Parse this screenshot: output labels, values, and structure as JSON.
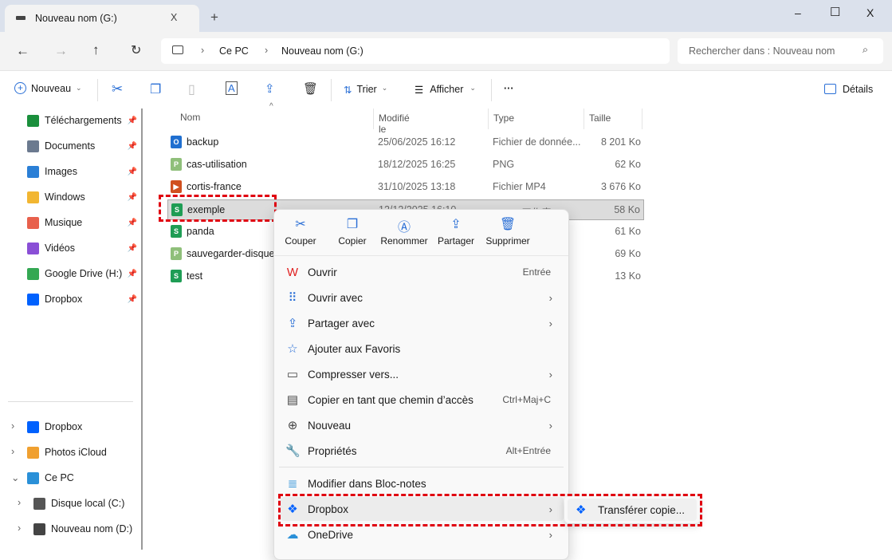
{
  "window": {
    "tab_title": "Nouveau nom (G:)",
    "tab_close": "X",
    "new_tab": "+",
    "minimize": "–",
    "maximize": "☐",
    "close": "X"
  },
  "address": {
    "crumbs": [
      "Ce PC",
      "Nouveau nom (G:)"
    ],
    "search_placeholder": "Rechercher dans : Nouveau nom"
  },
  "toolbar": {
    "new_label": "Nouveau",
    "sort_label": "Trier",
    "view_label": "Afficher",
    "more": "···",
    "details_label": "Détails"
  },
  "sidebar": {
    "quick": [
      {
        "label": "Téléchargements",
        "color": "#1a8f3c"
      },
      {
        "label": "Documents",
        "color": "#6b7a8f"
      },
      {
        "label": "Images",
        "color": "#2b7fd6"
      },
      {
        "label": "Windows",
        "color": "#f2b632"
      },
      {
        "label": "Musique",
        "color": "#e8604c"
      },
      {
        "label": "Vidéos",
        "color": "#8a4fd6"
      },
      {
        "label": "Google Drive (H:)",
        "color": "#34a853"
      },
      {
        "label": "Dropbox",
        "color": "#0061fe"
      }
    ],
    "tree": [
      {
        "label": "Dropbox",
        "color": "#0061fe",
        "chev": "›"
      },
      {
        "label": "Photos iCloud",
        "color": "#f0a030",
        "chev": "›"
      },
      {
        "label": "Ce PC",
        "color": "#2a90d8",
        "chev": "⌄"
      },
      {
        "label": "Disque local (C:)",
        "color": "#555",
        "chev": "›"
      },
      {
        "label": "Nouveau nom (D:)",
        "color": "#444",
        "chev": "›"
      }
    ]
  },
  "columns": {
    "name": "Nom",
    "modified": "Modifié le",
    "type": "Type",
    "size": "Taille"
  },
  "files": [
    {
      "name": "backup",
      "modified": "25/06/2025 16:12",
      "type": "Fichier de donnée...",
      "size": "8 201 Ko",
      "icon": "O",
      "color": "#1f6fd0"
    },
    {
      "name": "cas-utilisation",
      "modified": "18/12/2025 16:25",
      "type": "PNG",
      "size": "62 Ko",
      "icon": "P",
      "color": "#8fbf7a"
    },
    {
      "name": "cortis-france",
      "modified": "31/10/2025 13:18",
      "type": "Fichier MP4",
      "size": "3 676 Ko",
      "icon": "▶",
      "color": "#d0501f"
    },
    {
      "name": "exemple",
      "modified": "12/12/2025 16:10",
      "type": "XLSX 工作表",
      "size": "58 Ko",
      "icon": "S",
      "color": "#1f9d55"
    },
    {
      "name": "panda",
      "modified": "",
      "type": "",
      "size": "61 Ko",
      "icon": "S",
      "color": "#1f9d55"
    },
    {
      "name": "sauvegarder-disque-",
      "modified": "",
      "type": "",
      "size": "69 Ko",
      "icon": "P",
      "color": "#8fbf7a"
    },
    {
      "name": "test",
      "modified": "",
      "type": "",
      "size": "13 Ko",
      "icon": "S",
      "color": "#1f9d55"
    }
  ],
  "context_menu": {
    "quick_actions": [
      "Couper",
      "Copier",
      "Renommer",
      "Partager",
      "Supprimer"
    ],
    "items": [
      {
        "label": "Ouvrir",
        "shortcut": "Entrée",
        "icon": "W"
      },
      {
        "label": "Ouvrir avec",
        "arrow": "›",
        "icon": "⠿"
      },
      {
        "label": "Partager avec",
        "arrow": "›",
        "icon": "⇪"
      },
      {
        "label": "Ajouter aux Favoris",
        "icon": "☆"
      },
      {
        "label": "Compresser vers...",
        "arrow": "›",
        "icon": "▭"
      },
      {
        "label": "Copier en tant que chemin d’accès",
        "shortcut": "Ctrl+Maj+C",
        "icon": "▤"
      },
      {
        "label": "Nouveau",
        "arrow": "›",
        "icon": "⊕"
      },
      {
        "label": "Propriétés",
        "shortcut": "Alt+Entrée",
        "icon": "🔧"
      },
      {
        "label": "Modifier dans Bloc-notes",
        "icon": "≣"
      },
      {
        "label": "Dropbox",
        "arrow": "›",
        "icon": "❖"
      },
      {
        "label": "OneDrive",
        "arrow": "›",
        "icon": "☁"
      }
    ]
  },
  "submenu": {
    "label": "Transférer copie..."
  }
}
